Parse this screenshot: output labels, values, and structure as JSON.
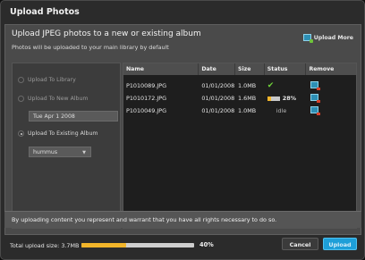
{
  "window": {
    "title": "Upload Photos"
  },
  "panel": {
    "heading": "Upload JPEG photos to a new or existing album",
    "subheading": "Photos will be uploaded to your main library by default",
    "upload_more": {
      "label": "Upload More",
      "icon": "photo-add-icon"
    }
  },
  "options": {
    "upload_to_library": "Upload To Library",
    "upload_to_new_album": "Upload To New Album",
    "new_album_name": "Tue Apr 1 2008",
    "upload_to_existing_album": "Upload To Existing Album",
    "existing_album_selected": "hummus",
    "selected_option": "upload_to_existing_album"
  },
  "table": {
    "headers": {
      "name": "Name",
      "date": "Date",
      "size": "Size",
      "status": "Status",
      "remove": "Remove"
    },
    "rows": [
      {
        "name": "P1010089.JPG",
        "date": "01/01/2008",
        "size": "1.0MB",
        "status": "done",
        "status_icon": "checkmark-icon",
        "status_text": ""
      },
      {
        "name": "P1010172.JPG",
        "date": "01/01/2008",
        "size": "1.6MB",
        "status": "uploading",
        "status_text": "28%",
        "progress": 0.28
      },
      {
        "name": "P1010049.JPG",
        "date": "01/01/2008",
        "size": "1.0MB",
        "status": "idle",
        "status_text": "idle"
      }
    ]
  },
  "footer": {
    "disclaimer": "By uploading content you represent and warrant that you have all rights necessary to do so.",
    "total_label": "Total upload size: 3.7MB",
    "progress": 0.4,
    "progress_text": "40%",
    "cancel_label": "Cancel",
    "upload_label": "Upload"
  },
  "colors": {
    "accent": "#1e9fd8",
    "progress": "#f2b52a",
    "success": "#6fd13a",
    "background": "#2b2b2b",
    "panel": "#4a4a4a"
  }
}
